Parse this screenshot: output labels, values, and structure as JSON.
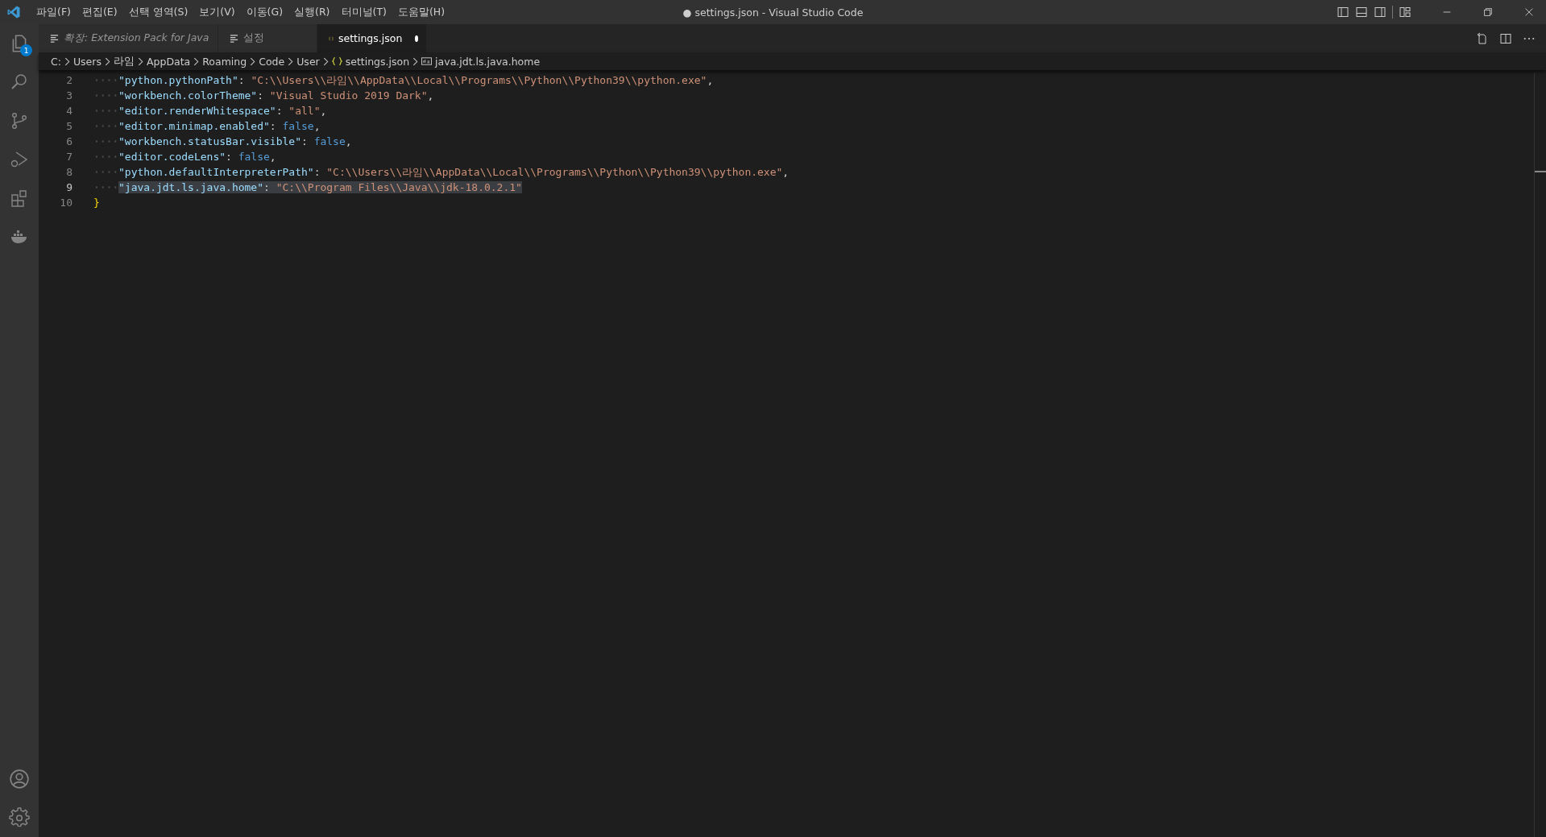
{
  "window": {
    "title": "● settings.json - Visual Studio Code"
  },
  "menu": [
    "파일(F)",
    "편집(E)",
    "선택 영역(S)",
    "보기(V)",
    "이동(G)",
    "실행(R)",
    "터미널(T)",
    "도움말(H)"
  ],
  "activity_bar": {
    "explorer_badge": "1"
  },
  "tabs": [
    {
      "label": "확장: Extension Pack for Java",
      "kind": "preview",
      "italic": true,
      "dirty": false,
      "selected": false
    },
    {
      "label": "설정",
      "kind": "preview",
      "italic": false,
      "dirty": false,
      "selected": false
    },
    {
      "label": "settings.json",
      "kind": "file",
      "italic": false,
      "dirty": true,
      "selected": true
    }
  ],
  "breadcrumbs": [
    {
      "label": "C:",
      "kind": "folder"
    },
    {
      "label": "Users",
      "kind": "folder"
    },
    {
      "label": "라임",
      "kind": "folder"
    },
    {
      "label": "AppData",
      "kind": "folder"
    },
    {
      "label": "Roaming",
      "kind": "folder"
    },
    {
      "label": "Code",
      "kind": "folder"
    },
    {
      "label": "User",
      "kind": "folder"
    },
    {
      "label": "settings.json",
      "kind": "file"
    },
    {
      "label": "java.jdt.ls.java.home",
      "kind": "symbol"
    }
  ],
  "editor": {
    "lines": [
      {
        "number": "2",
        "active": false,
        "selected": false,
        "tokens": [
          {
            "kind": "key",
            "text": "\"python.pythonPath\""
          },
          {
            "kind": "punct",
            "text": ": "
          },
          {
            "kind": "string",
            "text": "\"C:\\\\Users\\\\라임\\\\AppData\\\\Local\\\\Programs\\\\Python\\\\Python39\\\\python.exe\""
          },
          {
            "kind": "punct",
            "text": ","
          }
        ]
      },
      {
        "number": "3",
        "active": false,
        "selected": false,
        "tokens": [
          {
            "kind": "key",
            "text": "\"workbench.colorTheme\""
          },
          {
            "kind": "punct",
            "text": ": "
          },
          {
            "kind": "string",
            "text": "\"Visual Studio 2019 Dark\""
          },
          {
            "kind": "punct",
            "text": ","
          }
        ]
      },
      {
        "number": "4",
        "active": false,
        "selected": false,
        "tokens": [
          {
            "kind": "key",
            "text": "\"editor.renderWhitespace\""
          },
          {
            "kind": "punct",
            "text": ": "
          },
          {
            "kind": "string",
            "text": "\"all\""
          },
          {
            "kind": "punct",
            "text": ","
          }
        ]
      },
      {
        "number": "5",
        "active": false,
        "selected": false,
        "tokens": [
          {
            "kind": "key",
            "text": "\"editor.minimap.enabled\""
          },
          {
            "kind": "punct",
            "text": ": "
          },
          {
            "kind": "boolean",
            "text": "false"
          },
          {
            "kind": "punct",
            "text": ","
          }
        ]
      },
      {
        "number": "6",
        "active": false,
        "selected": false,
        "tokens": [
          {
            "kind": "key",
            "text": "\"workbench.statusBar.visible\""
          },
          {
            "kind": "punct",
            "text": ": "
          },
          {
            "kind": "boolean",
            "text": "false"
          },
          {
            "kind": "punct",
            "text": ","
          }
        ]
      },
      {
        "number": "7",
        "active": false,
        "selected": false,
        "tokens": [
          {
            "kind": "key",
            "text": "\"editor.codeLens\""
          },
          {
            "kind": "punct",
            "text": ": "
          },
          {
            "kind": "boolean",
            "text": "false"
          },
          {
            "kind": "punct",
            "text": ","
          }
        ]
      },
      {
        "number": "8",
        "active": false,
        "selected": false,
        "tokens": [
          {
            "kind": "key",
            "text": "\"python.defaultInterpreterPath\""
          },
          {
            "kind": "punct",
            "text": ": "
          },
          {
            "kind": "string",
            "text": "\"C:\\\\Users\\\\라임\\\\AppData\\\\Local\\\\Programs\\\\Python\\\\Python39\\\\python.exe\""
          },
          {
            "kind": "punct",
            "text": ","
          }
        ]
      },
      {
        "number": "9",
        "active": true,
        "selected": true,
        "tokens": [
          {
            "kind": "key",
            "text": "\"java.jdt.ls.java.home\""
          },
          {
            "kind": "punct",
            "text": ": "
          },
          {
            "kind": "string",
            "text": "\"C:\\\\Program Files\\\\Java\\\\jdk-18.0.2.1\""
          }
        ]
      },
      {
        "number": "10",
        "active": false,
        "selected": false,
        "tokens": [
          {
            "kind": "brace",
            "text": "}"
          }
        ]
      }
    ]
  }
}
